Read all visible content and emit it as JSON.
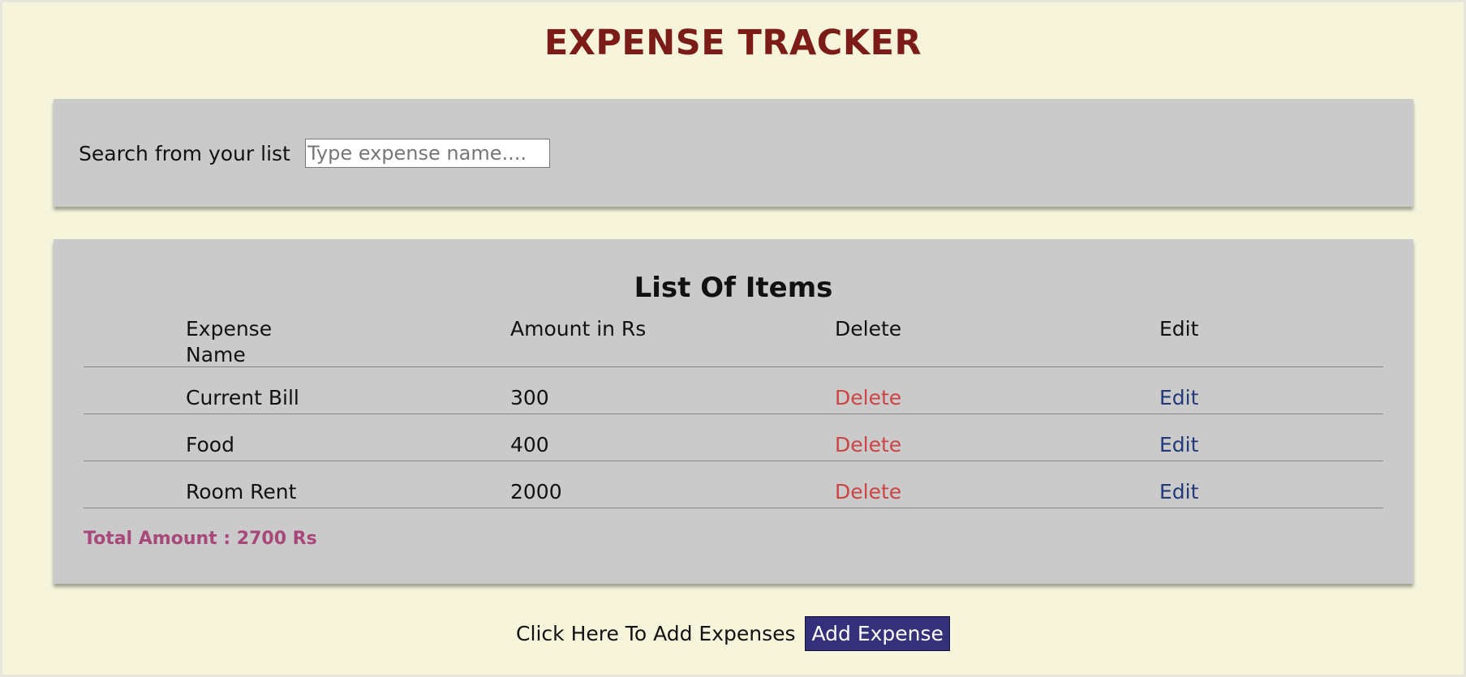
{
  "header": {
    "title": "EXPENSE TRACKER"
  },
  "search": {
    "label": "Search from your list",
    "placeholder": "Type expense name....",
    "value": ""
  },
  "list": {
    "title": "List Of Items",
    "columns": {
      "name": "Expense Name",
      "amount": "Amount in Rs",
      "delete": "Delete",
      "edit": "Edit"
    },
    "rows": [
      {
        "name": "Current Bill",
        "amount": "300",
        "delete": "Delete",
        "edit": "Edit"
      },
      {
        "name": "Food",
        "amount": "400",
        "delete": "Delete",
        "edit": "Edit"
      },
      {
        "name": "Room Rent",
        "amount": "2000",
        "delete": "Delete",
        "edit": "Edit"
      }
    ],
    "total": "Total Amount : 2700 Rs"
  },
  "footer": {
    "prompt": "Click Here To Add Expenses",
    "add_button_label": "Add Expense"
  },
  "colors": {
    "background": "#f6f5dc",
    "title": "#7c1c18",
    "card": "#cacaca",
    "delete_link": "#cc4444",
    "edit_link": "#233a78",
    "total": "#a8477a",
    "button": "#34317a"
  }
}
